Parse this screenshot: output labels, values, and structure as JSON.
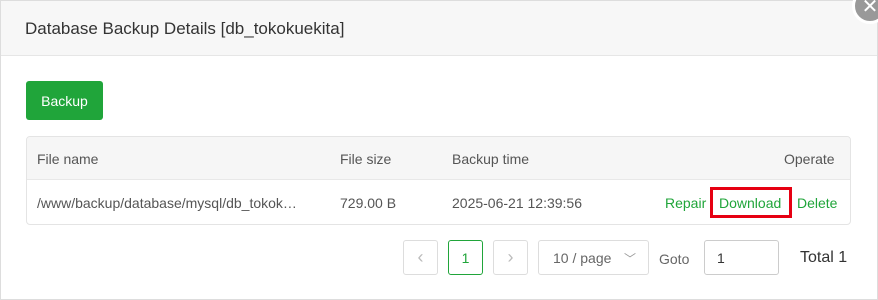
{
  "dialog": {
    "title": "Database Backup Details [db_tokokuekita]",
    "close_icon": "close-icon"
  },
  "toolbar": {
    "backup_label": "Backup"
  },
  "table": {
    "headers": {
      "file_name": "File name",
      "file_size": "File size",
      "backup_time": "Backup time",
      "operate": "Operate"
    },
    "rows": [
      {
        "file_name": "/www/backup/database/mysql/db_tokok…",
        "file_size": "729.00 B",
        "backup_time": "2025-06-21 12:39:56",
        "ops": {
          "repair": "Repair",
          "download": "Download",
          "delete": "Delete"
        }
      }
    ]
  },
  "pagination": {
    "prev_icon": "chevron-left-icon",
    "current_page": "1",
    "next_icon": "chevron-right-icon",
    "page_size": "10 / page",
    "goto_label": "Goto",
    "goto_value": "1",
    "total": "Total 1"
  },
  "colors": {
    "accent": "#20a53a",
    "highlight": "#e60012"
  }
}
